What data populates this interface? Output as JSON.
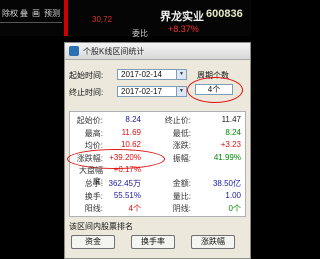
{
  "toolbar": {
    "tabs": [
      "除权",
      "叠",
      "画",
      "预测"
    ],
    "price": "30.72"
  },
  "stock": {
    "name": "界龙实业",
    "code": "600836",
    "change": "+8.37%",
    "side_label": "委比"
  },
  "dialog": {
    "title": "个股K线区间统计",
    "start_label": "起始时间:",
    "start_value": "2017-02-14",
    "end_label": "终止时间:",
    "end_value": "2017-02-17",
    "days_label": "周期个数",
    "days_value": "4个",
    "stats_left": [
      {
        "label": "起始价:",
        "value": "8.24",
        "color": "#1a1aa0"
      },
      {
        "label": "最高:",
        "value": "11.69",
        "color": "#e01010"
      },
      {
        "label": "均价:",
        "value": "10.62",
        "color": "#e01010"
      },
      {
        "label": "涨跌幅:",
        "value": "+39.20%",
        "color": "#e01010"
      },
      {
        "label": "大盘幅度:",
        "value": "+0.17%",
        "color": "#e01010"
      },
      {
        "label": "总手:",
        "value": "362.45万",
        "color": "#1a1aa0"
      },
      {
        "label": "换手:",
        "value": "55.51%",
        "color": "#1a1aa0"
      },
      {
        "label": "阳线:",
        "value": "4个",
        "color": "#e01010"
      }
    ],
    "stats_right": [
      {
        "label": "终止价:",
        "value": "11.47",
        "color": "#222222"
      },
      {
        "label": "最低:",
        "value": "8.24",
        "color": "#008a00"
      },
      {
        "label": "涨跌:",
        "value": "+3.23",
        "color": "#e01010"
      },
      {
        "label": "振幅:",
        "value": "41.99%",
        "color": "#008a00"
      },
      {
        "label": "",
        "value": "",
        "color": "#222222"
      },
      {
        "label": "金额:",
        "value": "38.50亿",
        "color": "#1a1aa0"
      },
      {
        "label": "量比:",
        "value": "1.00",
        "color": "#1a1aa0"
      },
      {
        "label": "阴线:",
        "value": "0个",
        "color": "#008a00"
      }
    ],
    "rank_label": "该区间内股票排名",
    "buttons": [
      "资金",
      "换手率",
      "涨跌幅"
    ]
  }
}
